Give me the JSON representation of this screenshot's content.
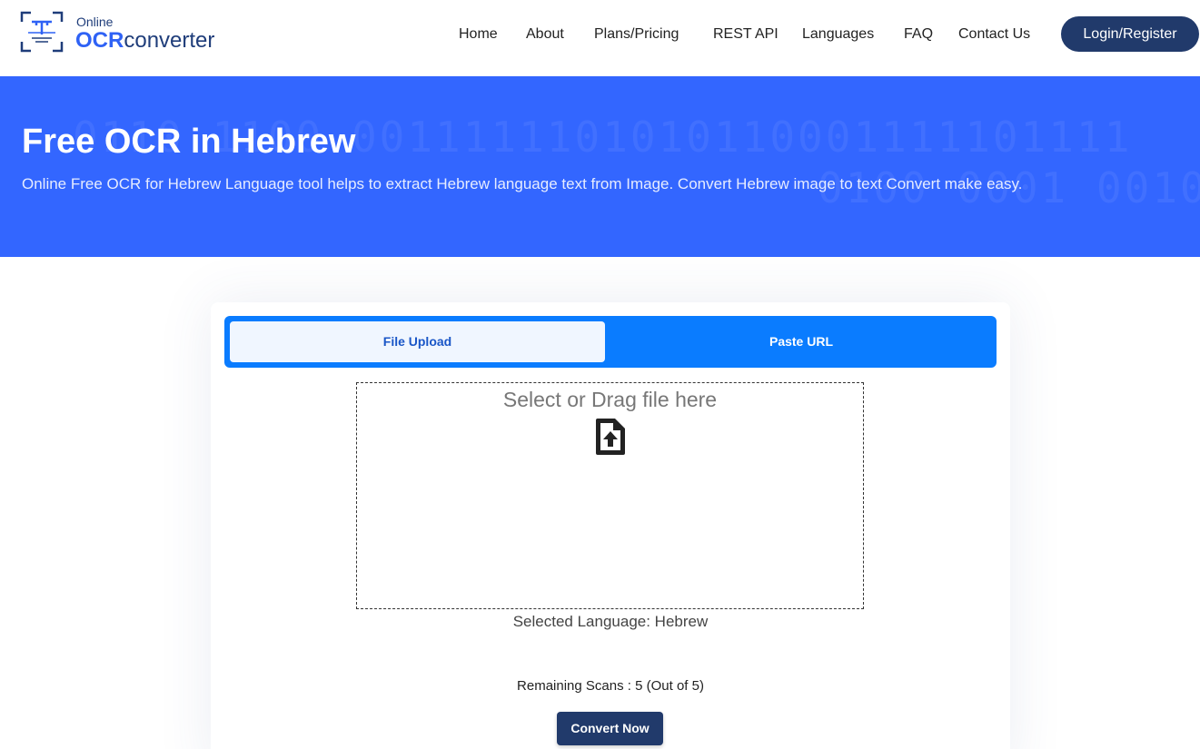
{
  "logo": {
    "small": "Online",
    "brand_bold": "OCR",
    "brand_rest": "converter",
    "icon": "ocr-scan-icon"
  },
  "nav": {
    "items": [
      "Home",
      "About",
      "Plans/Pricing",
      "REST API",
      "Languages",
      "FAQ",
      "Contact Us"
    ],
    "login_label": "Login/Register"
  },
  "hero": {
    "title": "Free OCR in Hebrew",
    "subtitle": "Online Free OCR for Hebrew Language tool helps to extract Hebrew language text from Image. Convert Hebrew image to text Convert make easy."
  },
  "tool": {
    "tabs": [
      "File Upload",
      "Paste URL"
    ],
    "active_tab": "File Upload",
    "dropzone_label": "Select or Drag file here",
    "dropzone_icon": "file-upload-icon",
    "language_text": "Selected Language: Hebrew",
    "remaining_scans": "Remaining Scans : 5 (Out of 5)",
    "convert_label": "Convert Now"
  },
  "colors": {
    "brand_blue": "#3366ff",
    "tab_blue": "#0a7cff",
    "navy": "#213a6b"
  }
}
